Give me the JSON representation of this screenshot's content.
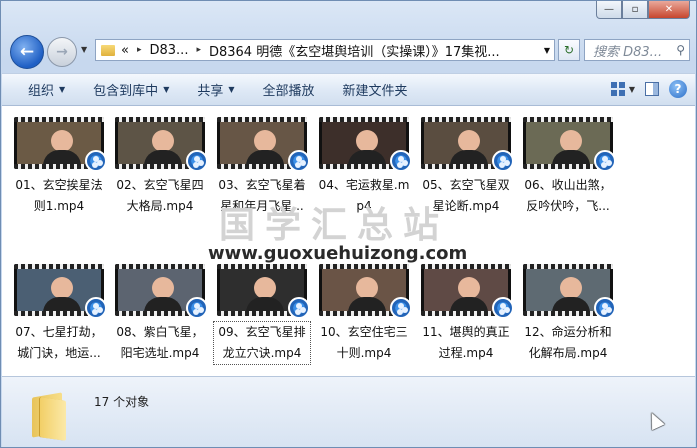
{
  "window": {
    "buttons": {
      "minimize": "—",
      "maximize": "▫",
      "close": "✕"
    }
  },
  "address": {
    "lead": "«",
    "segments": [
      "D83...",
      "D8364 明德《玄空堪舆培训（实操课）》17集视..."
    ],
    "separator": "▸"
  },
  "search": {
    "placeholder": "搜索 D83..."
  },
  "toolbar": {
    "organize": "组织",
    "include_library": "包含到库中",
    "share": "共享",
    "play_all": "全部播放",
    "new_folder": "新建文件夹"
  },
  "files": [
    {
      "name": "01、玄空挨星法则1.mp4",
      "color": "#6b5a45"
    },
    {
      "name": "02、玄空飞星四大格局.mp4",
      "color": "#5d5446"
    },
    {
      "name": "03、玄空飞星着星和年月飞星...",
      "color": "#675646"
    },
    {
      "name": "04、宅运救星.mp4",
      "color": "#3d2f2a"
    },
    {
      "name": "05、玄空飞星双星论断.mp4",
      "color": "#5a4d40"
    },
    {
      "name": "06、收山出煞，反吟伏吟，飞...",
      "color": "#6b6a55"
    },
    {
      "name": "07、七星打劫，城门诀，地运...",
      "color": "#4b5f73"
    },
    {
      "name": "08、紫白飞星，阳宅选址.mp4",
      "color": "#5c6470"
    },
    {
      "name": "09、玄空飞星排龙立穴诀.mp4",
      "color": "#2e2e2e"
    },
    {
      "name": "10、玄空住宅三十则.mp4",
      "color": "#6a5446"
    },
    {
      "name": "11、堪舆的真正过程.mp4",
      "color": "#5f4a45"
    },
    {
      "name": "12、命运分析和化解布局.mp4",
      "color": "#5e6a72"
    }
  ],
  "watermark": {
    "cn": "国学汇总站",
    "url": "www.guoxuehuizong.com"
  },
  "status": {
    "count": "17 个对象"
  }
}
